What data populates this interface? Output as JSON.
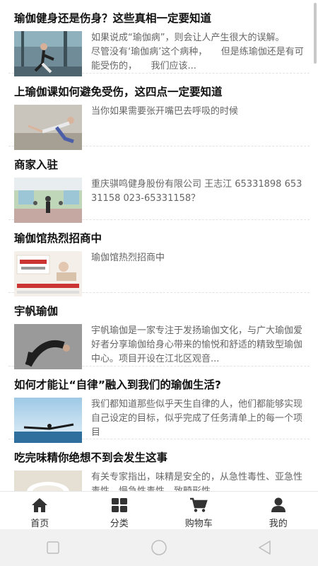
{
  "articles": [
    {
      "title": "瑜伽健身还是伤身？这些真相一定要知道",
      "desc": "如果说成“瑜伽病”，则会让人产生很大的误解。　　尽管没有‘瑜伽病’这个病种，　　但是练瑜伽还是有可能受伤的，　　我们应该..."
    },
    {
      "title": "上瑜伽课如何避免受伤，这四点一定要知道",
      "desc": "当你如果需要张开嘴巴去呼吸的时候"
    },
    {
      "title": "商家入驻",
      "desc": "重庆骐鸣健身股份有限公司 王志江 65331898 65331158 023-65331158？"
    },
    {
      "title": "瑜伽馆热烈招商中",
      "desc": "瑜伽馆热烈招商中"
    },
    {
      "title": "宇帆瑜伽",
      "desc": "宇帆瑜伽是一家专注于发扬瑜伽文化，与广大瑜伽爱好者分享瑜伽给身心带来的愉悦和舒适的精致型瑜伽中心。项目开设在江北区观音..."
    },
    {
      "title": "如何才能让“自律”融入到我们的瑜伽生活?",
      "desc": "我们都知道那些似乎天生自律的人，他们都能够实现自己设定的目标，似乎完成了任务清单上的每一个项目"
    },
    {
      "title": "吃完味精你绝想不到会发生这事",
      "desc": "有关专家指出，味精是安全的，从急性毒性、亚急性毒性、慢急性毒性、致畸形性..."
    }
  ],
  "tabbar": {
    "home": "首页",
    "category": "分类",
    "cart": "购物车",
    "mine": "我的"
  },
  "colors": {
    "title": "#111111",
    "desc": "#666666",
    "icon": "#333333",
    "divider": "#e3e3e3"
  }
}
